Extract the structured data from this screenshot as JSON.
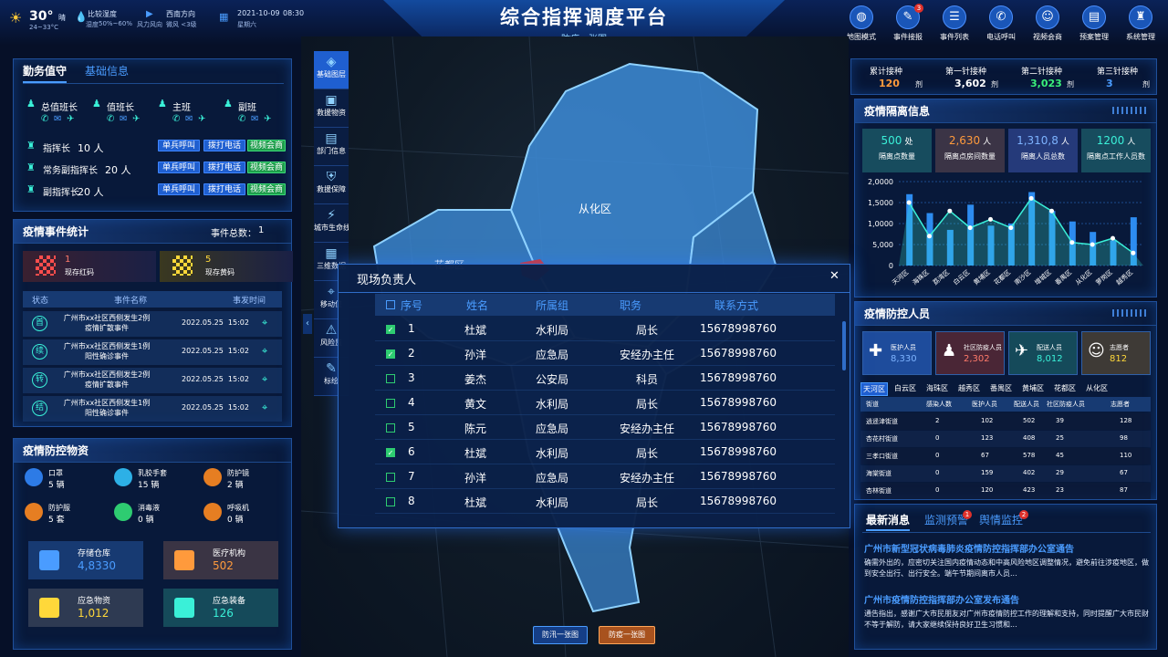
{
  "header": {
    "title": "综合指挥调度平台",
    "subtitle": "防疫一张图",
    "weather": {
      "temp": "30°",
      "temp_unit": "晴",
      "range": "24~33°C",
      "humidity_label": "比较湿度",
      "humidity_sub": "湿度",
      "humidity_val": "50%~60%",
      "wind_label": "西南方向",
      "wind_sub": "风力风向",
      "wind_val": "微风 <3级",
      "date": "2021-10-09",
      "time": "08:30",
      "weekday": "星期六"
    },
    "toolbar": [
      {
        "label": "地图模式",
        "icon": "globe-icon",
        "glyph": "◍"
      },
      {
        "label": "事件接报",
        "icon": "edit-report-icon",
        "glyph": "✎",
        "badge": "3"
      },
      {
        "label": "事件列表",
        "icon": "list-icon",
        "glyph": "☰"
      },
      {
        "label": "电话呼叫",
        "icon": "phone-icon",
        "glyph": "✆"
      },
      {
        "label": "视频会商",
        "icon": "video-meeting-icon",
        "glyph": "☺"
      },
      {
        "label": "预案管理",
        "icon": "clipboard-icon",
        "glyph": "▤"
      },
      {
        "label": "系统管理",
        "icon": "hierarchy-icon",
        "glyph": "♜"
      }
    ]
  },
  "duty": {
    "tabs": [
      "勤务值守",
      "基础信息"
    ],
    "roles": [
      "总值班长",
      "值班长",
      "主班",
      "副班"
    ],
    "rows": [
      {
        "label": "指挥长",
        "count": "10 人"
      },
      {
        "label": "常务副指挥长",
        "count": "20 人"
      },
      {
        "label": "副指挥长",
        "count": "20 人"
      }
    ],
    "btn_call": "单兵呼叫",
    "btn_phone": "拨打电话",
    "btn_video": "视频会商"
  },
  "events": {
    "title": "疫情事件统计",
    "total_label": "事件总数：",
    "total": "1",
    "red_count": "1",
    "red_label": "现存红码",
    "yellow_count": "5",
    "yellow_label": "现存黄码",
    "columns": [
      "状态",
      "事件名称",
      "事发时间"
    ],
    "rows": [
      {
        "status": "首",
        "name": "广州市xx社区西侧发生2例疫情扩散事件",
        "time": "2022.05.25  15:02"
      },
      {
        "status": "续",
        "name": "广州市xx社区西侧发生1例阳性确诊事件",
        "time": "2022.05.25  15:02"
      },
      {
        "status": "转",
        "name": "广州市xx社区西侧发生2例疫情扩散事件",
        "time": "2022.05.25  15:02"
      },
      {
        "status": "结",
        "name": "广州市xx社区西侧发生1例阳性确诊事件",
        "time": "2022.05.25  15:02"
      }
    ]
  },
  "supplies": {
    "title": "疫情防控物资",
    "items": [
      {
        "name": "口罩",
        "val": "5 辆",
        "color": "#2d7be6"
      },
      {
        "name": "乳胶手套",
        "val": "15 辆",
        "color": "#2db0e6"
      },
      {
        "name": "防护镜",
        "val": "2 辆",
        "color": "#e67e22"
      },
      {
        "name": "防护服",
        "val": "5 套",
        "color": "#e67e22"
      },
      {
        "name": "消毒液",
        "val": "0 辆",
        "color": "#2ecc71"
      },
      {
        "name": "呼吸机",
        "val": "0 辆",
        "color": "#e67e22"
      }
    ],
    "cards": [
      {
        "name": "存储仓库",
        "val": "4,8330",
        "color": "#4a9cff",
        "bg": "#173a72"
      },
      {
        "name": "医疗机构",
        "val": "502",
        "color": "#ff9a3c",
        "bg": "#3a3444"
      },
      {
        "name": "应急物资",
        "val": "1,012",
        "color": "#ffd83a",
        "bg": "#2e3a52"
      },
      {
        "name": "应急装备",
        "val": "126",
        "color": "#3af0d8",
        "bg": "#154a5a"
      }
    ]
  },
  "map": {
    "district": "从化区",
    "district2": "花都区",
    "bottom_tabs": [
      "防汛一张图",
      "防疫一张图"
    ]
  },
  "sidetools": [
    "基础图层",
    "救援物资",
    "部门信息",
    "救援保障",
    "城市生命线",
    "三维数据",
    "移动位",
    "风险监",
    "标绘"
  ],
  "modal": {
    "title": "现场负责人",
    "close": "✕",
    "columns": [
      "序号",
      "姓名",
      "所属组",
      "职务",
      "联系方式"
    ],
    "rows": [
      {
        "checked": true,
        "no": "1",
        "name": "杜斌",
        "group": "水利局",
        "duty": "局长",
        "phone": "15678998760"
      },
      {
        "checked": true,
        "no": "2",
        "name": "孙洋",
        "group": "应急局",
        "duty": "安经办主任",
        "phone": "15678998760"
      },
      {
        "checked": false,
        "no": "3",
        "name": "姜杰",
        "group": "公安局",
        "duty": "科员",
        "phone": "15678998760"
      },
      {
        "checked": false,
        "no": "4",
        "name": "黄文",
        "group": "水利局",
        "duty": "局长",
        "phone": "15678998760"
      },
      {
        "checked": false,
        "no": "5",
        "name": "陈元",
        "group": "应急局",
        "duty": "安经办主任",
        "phone": "15678998760"
      },
      {
        "checked": true,
        "no": "6",
        "name": "杜斌",
        "group": "水利局",
        "duty": "局长",
        "phone": "15678998760"
      },
      {
        "checked": false,
        "no": "7",
        "name": "孙洋",
        "group": "应急局",
        "duty": "安经办主任",
        "phone": "15678998760"
      },
      {
        "checked": false,
        "no": "8",
        "name": "杜斌",
        "group": "水利局",
        "duty": "局长",
        "phone": "15678998760"
      }
    ]
  },
  "vaccine": [
    {
      "label": "累计接种",
      "val": "120",
      "unit": "剂",
      "color": "#ff9a3c"
    },
    {
      "label": "第一针接种",
      "val": "3,602",
      "unit": "剂",
      "color": "#ffffff"
    },
    {
      "label": "第二针接种",
      "val": "3,023",
      "unit": "剂",
      "color": "#3af07a"
    },
    {
      "label": "第三针接种",
      "val": "3",
      "unit": "剂",
      "color": "#4a9cff"
    }
  ],
  "isolation": {
    "title": "疫情隔离信息",
    "cards": [
      {
        "val": "500",
        "unit": "处",
        "label": "隔离点数量",
        "color": "#3af0d8",
        "bg": "#174c5e"
      },
      {
        "val": "2,630",
        "unit": "人",
        "label": "隔离点房间数量",
        "color": "#ff9a3c",
        "bg": "#3b3446"
      },
      {
        "val": "1,310,8",
        "unit": "人",
        "label": "隔离人员总数",
        "color": "#7db3ff",
        "bg": "#253a7a"
      },
      {
        "val": "1200",
        "unit": "人",
        "label": "隔离点工作人员数",
        "color": "#3af0d8",
        "bg": "#174c5e"
      }
    ]
  },
  "chart_data": {
    "type": "bar",
    "categories": [
      "天河区",
      "海珠区",
      "荔湾区",
      "白云区",
      "黄埔区",
      "花都区",
      "南沙区",
      "增城区",
      "番禺区",
      "从化区",
      "萝岗区",
      "越秀区"
    ],
    "values": [
      1700,
      1250,
      850,
      1450,
      950,
      1000,
      1750,
      1300,
      1050,
      800,
      600,
      1150
    ],
    "line_values": [
      1500,
      700,
      1300,
      900,
      1100,
      900,
      1600,
      1300,
      550,
      500,
      650,
      300
    ],
    "ylim": [
      0,
      2000
    ],
    "yticks": [
      "2,0000",
      "1,5000",
      "1,0000",
      "5,000",
      "0"
    ]
  },
  "control": {
    "title": "疫情防控人员",
    "cards": [
      {
        "label": "医护人员",
        "val": "8,330",
        "color": "#7db3ff",
        "bg": "#1e4c9c",
        "icon": "ambulance-icon",
        "glyph": "✚"
      },
      {
        "label": "社区防疫人员",
        "val": "2,302",
        "color": "#ff7a6a",
        "bg": "#4a2636",
        "icon": "community-worker-icon",
        "glyph": "♟"
      },
      {
        "label": "配送人员",
        "val": "8,012",
        "color": "#3af0d8",
        "bg": "#154a5a",
        "icon": "courier-icon",
        "glyph": "✈"
      },
      {
        "label": "志愿者",
        "val": "812",
        "color": "#ffd83a",
        "bg": "#3e3a36",
        "icon": "volunteer-icon",
        "glyph": "☺"
      }
    ],
    "tabs": [
      "天河区",
      "白云区",
      "海珠区",
      "越秀区",
      "番禺区",
      "黄埔区",
      "花都区",
      "从化区"
    ],
    "columns": [
      "街道",
      "感染人数",
      "医护人员",
      "配送人员",
      "社区防疫人员",
      "志愿者"
    ],
    "rows": [
      [
        "逍遥津街道",
        "2",
        "102",
        "502",
        "39",
        "128"
      ],
      [
        "杏花村街道",
        "0",
        "123",
        "408",
        "25",
        "98"
      ],
      [
        "三孝口街道",
        "0",
        "67",
        "578",
        "45",
        "110"
      ],
      [
        "海棠街道",
        "0",
        "159",
        "402",
        "29",
        "67"
      ],
      [
        "杏林街道",
        "0",
        "120",
        "423",
        "23",
        "87"
      ]
    ]
  },
  "news": {
    "tabs": [
      "最新消息",
      "监测预警",
      "舆情监控"
    ],
    "badges": [
      "1",
      "2"
    ],
    "items": [
      {
        "title": "广州市新型冠状病毒肺炎疫情防控指挥部办公室通告",
        "body": "确需外出的，应密切关注国内疫情动态和中高风险地区调整情况，避免前往涉疫地区，做到安全出行、出行安全。端午节期间离市人员..."
      },
      {
        "title": "广州市疫情防控指挥部办公室发布通告",
        "body": "通告指出，感谢广大市民朋友对广州市疫情防控工作的理解和支持，同时提醒广大市民财不等于解防，请大家继续保持良好卫生习惯和..."
      }
    ]
  }
}
